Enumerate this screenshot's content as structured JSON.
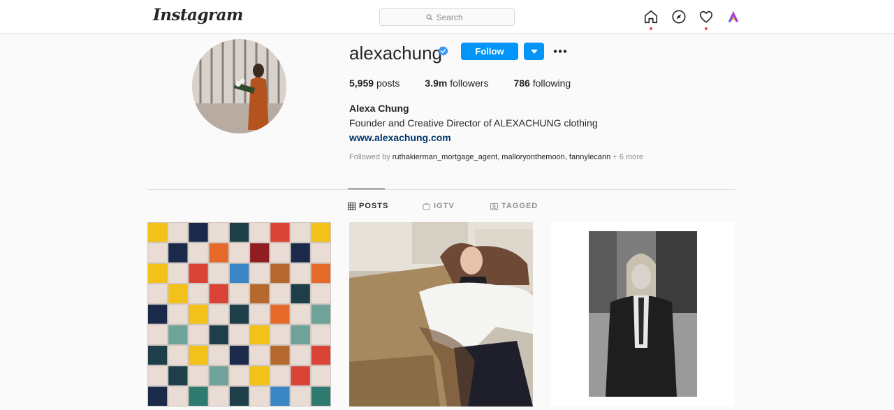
{
  "nav": {
    "logo": "Instagram",
    "search_placeholder": "Search",
    "icons": [
      "home-icon",
      "explore-compass-icon",
      "activity-heart-icon",
      "profile-avatar-icon"
    ]
  },
  "profile": {
    "username": "alexachung",
    "verified": true,
    "follow_label": "Follow",
    "posts_count": "5,959",
    "posts_label": "posts",
    "followers_count": "3.9m",
    "followers_label": "followers",
    "following_count": "786",
    "following_label": "following",
    "full_name": "Alexa Chung",
    "bio": "Founder and Creative Director of ALEXACHUNG clothing",
    "website": "www.alexachung.com",
    "followed_by_prefix": "Followed by",
    "followed_by_names": "ruthakierman_mortgage_agent, malloryonthemoon, fannylecann",
    "followed_by_more": "+ 6 more"
  },
  "tabs": [
    {
      "label": "POSTS",
      "icon": "grid-icon",
      "active": true
    },
    {
      "label": "IGTV",
      "icon": "igtv-icon",
      "active": false
    },
    {
      "label": "TAGGED",
      "icon": "tagged-icon",
      "active": false
    }
  ],
  "posts": [
    {
      "description_icon": "patchwork-quilt-photo"
    },
    {
      "description_icon": "woman-at-table-photo"
    },
    {
      "description_icon": "black-and-white-portrait-photo"
    }
  ],
  "colors": {
    "accent": "#0095f6",
    "link": "#00376b",
    "notification_dot": "#ed4956",
    "verified": "#3897f0"
  }
}
